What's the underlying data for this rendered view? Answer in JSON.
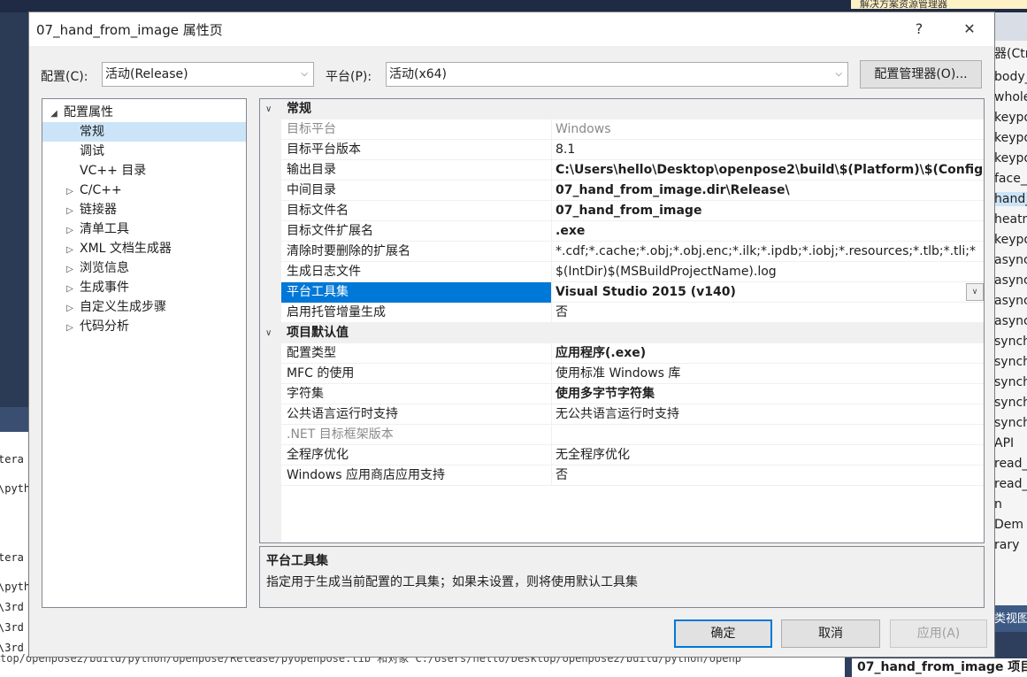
{
  "background": {
    "notice_text": "解决方案资源管理器",
    "console_lines": [
      "tera",
      "\\pyth",
      "tera",
      "\\pyth",
      "\\3rd",
      "\\3rd",
      "\\3rd"
    ],
    "bottom_log": "top/openpose2/build/python/openpose/Release/pyopenpose.lib 和对象 C:/Users/hello/Desktop/openpose2/build/python/openp",
    "right_search_label": "器(Ctr",
    "right_items": [
      "body_",
      "whole",
      "keypo",
      "keypo",
      "keypo",
      "face_f",
      "hand_",
      "heatm",
      "keypo",
      "async",
      "async",
      "async",
      "async",
      "synch",
      "synch",
      "synch",
      "synch",
      "synch",
      "API",
      "read_",
      "read_",
      "n",
      "Dem",
      "rary"
    ],
    "right_tab_label": "类视图",
    "right_bottom_label": "07_hand_from_image 项目"
  },
  "dialog": {
    "title": "07_hand_from_image 属性页",
    "help_label": "?",
    "close_label": "✕",
    "config_label": "配置(C):",
    "config_value": "活动(Release)",
    "platform_label": "平台(P):",
    "platform_value": "活动(x64)",
    "config_manager_label": "配置管理器(O)...",
    "tree": [
      {
        "label": "配置属性",
        "expander": "◢",
        "level": 0,
        "selected": false
      },
      {
        "label": "常规",
        "expander": "",
        "level": 1,
        "selected": true
      },
      {
        "label": "调试",
        "expander": "",
        "level": 1,
        "selected": false
      },
      {
        "label": "VC++ 目录",
        "expander": "",
        "level": 1,
        "selected": false
      },
      {
        "label": "C/C++",
        "expander": "▷",
        "level": 1,
        "selected": false
      },
      {
        "label": "链接器",
        "expander": "▷",
        "level": 1,
        "selected": false
      },
      {
        "label": "清单工具",
        "expander": "▷",
        "level": 1,
        "selected": false
      },
      {
        "label": "XML 文档生成器",
        "expander": "▷",
        "level": 1,
        "selected": false
      },
      {
        "label": "浏览信息",
        "expander": "▷",
        "level": 1,
        "selected": false
      },
      {
        "label": "生成事件",
        "expander": "▷",
        "level": 1,
        "selected": false
      },
      {
        "label": "自定义生成步骤",
        "expander": "▷",
        "level": 1,
        "selected": false
      },
      {
        "label": "代码分析",
        "expander": "▷",
        "level": 1,
        "selected": false
      }
    ],
    "categories": [
      {
        "name": "常规",
        "props": [
          {
            "name": "目标平台",
            "value": "Windows",
            "disabled": true,
            "bold": false
          },
          {
            "name": "目标平台版本",
            "value": "8.1",
            "disabled": false,
            "bold": false
          },
          {
            "name": "输出目录",
            "value": "C:\\Users\\hello\\Desktop\\openpose2\\build\\$(Platform)\\$(Configu",
            "disabled": false,
            "bold": true
          },
          {
            "name": "中间目录",
            "value": "07_hand_from_image.dir\\Release\\",
            "disabled": false,
            "bold": true
          },
          {
            "name": "目标文件名",
            "value": "07_hand_from_image",
            "disabled": false,
            "bold": true
          },
          {
            "name": "目标文件扩展名",
            "value": ".exe",
            "disabled": false,
            "bold": true
          },
          {
            "name": "清除时要删除的扩展名",
            "value": "*.cdf;*.cache;*.obj;*.obj.enc;*.ilk;*.ipdb;*.iobj;*.resources;*.tlb;*.tli;*",
            "disabled": false,
            "bold": false
          },
          {
            "name": "生成日志文件",
            "value": "$(IntDir)$(MSBuildProjectName).log",
            "disabled": false,
            "bold": false
          },
          {
            "name": "平台工具集",
            "value": "Visual Studio 2015 (v140)",
            "disabled": false,
            "bold": true,
            "selected": true
          },
          {
            "name": "启用托管增量生成",
            "value": "否",
            "disabled": false,
            "bold": false
          }
        ]
      },
      {
        "name": "项目默认值",
        "props": [
          {
            "name": "配置类型",
            "value": "应用程序(.exe)",
            "disabled": false,
            "bold": true
          },
          {
            "name": "MFC 的使用",
            "value": "使用标准 Windows 库",
            "disabled": false,
            "bold": false
          },
          {
            "name": "字符集",
            "value": "使用多字节字符集",
            "disabled": false,
            "bold": true
          },
          {
            "name": "公共语言运行时支持",
            "value": "无公共语言运行时支持",
            "disabled": false,
            "bold": false
          },
          {
            "name": ".NET 目标框架版本",
            "value": "",
            "disabled": true,
            "bold": false
          },
          {
            "name": "全程序优化",
            "value": "无全程序优化",
            "disabled": false,
            "bold": false
          },
          {
            "name": "Windows 应用商店应用支持",
            "value": "否",
            "disabled": false,
            "bold": false
          }
        ]
      }
    ],
    "description_title": "平台工具集",
    "description_text": "指定用于生成当前配置的工具集；如果未设置，则将使用默认工具集",
    "ok_label": "确定",
    "cancel_label": "取消",
    "apply_label": "应用(A)",
    "accent_color": "#0078d7"
  }
}
